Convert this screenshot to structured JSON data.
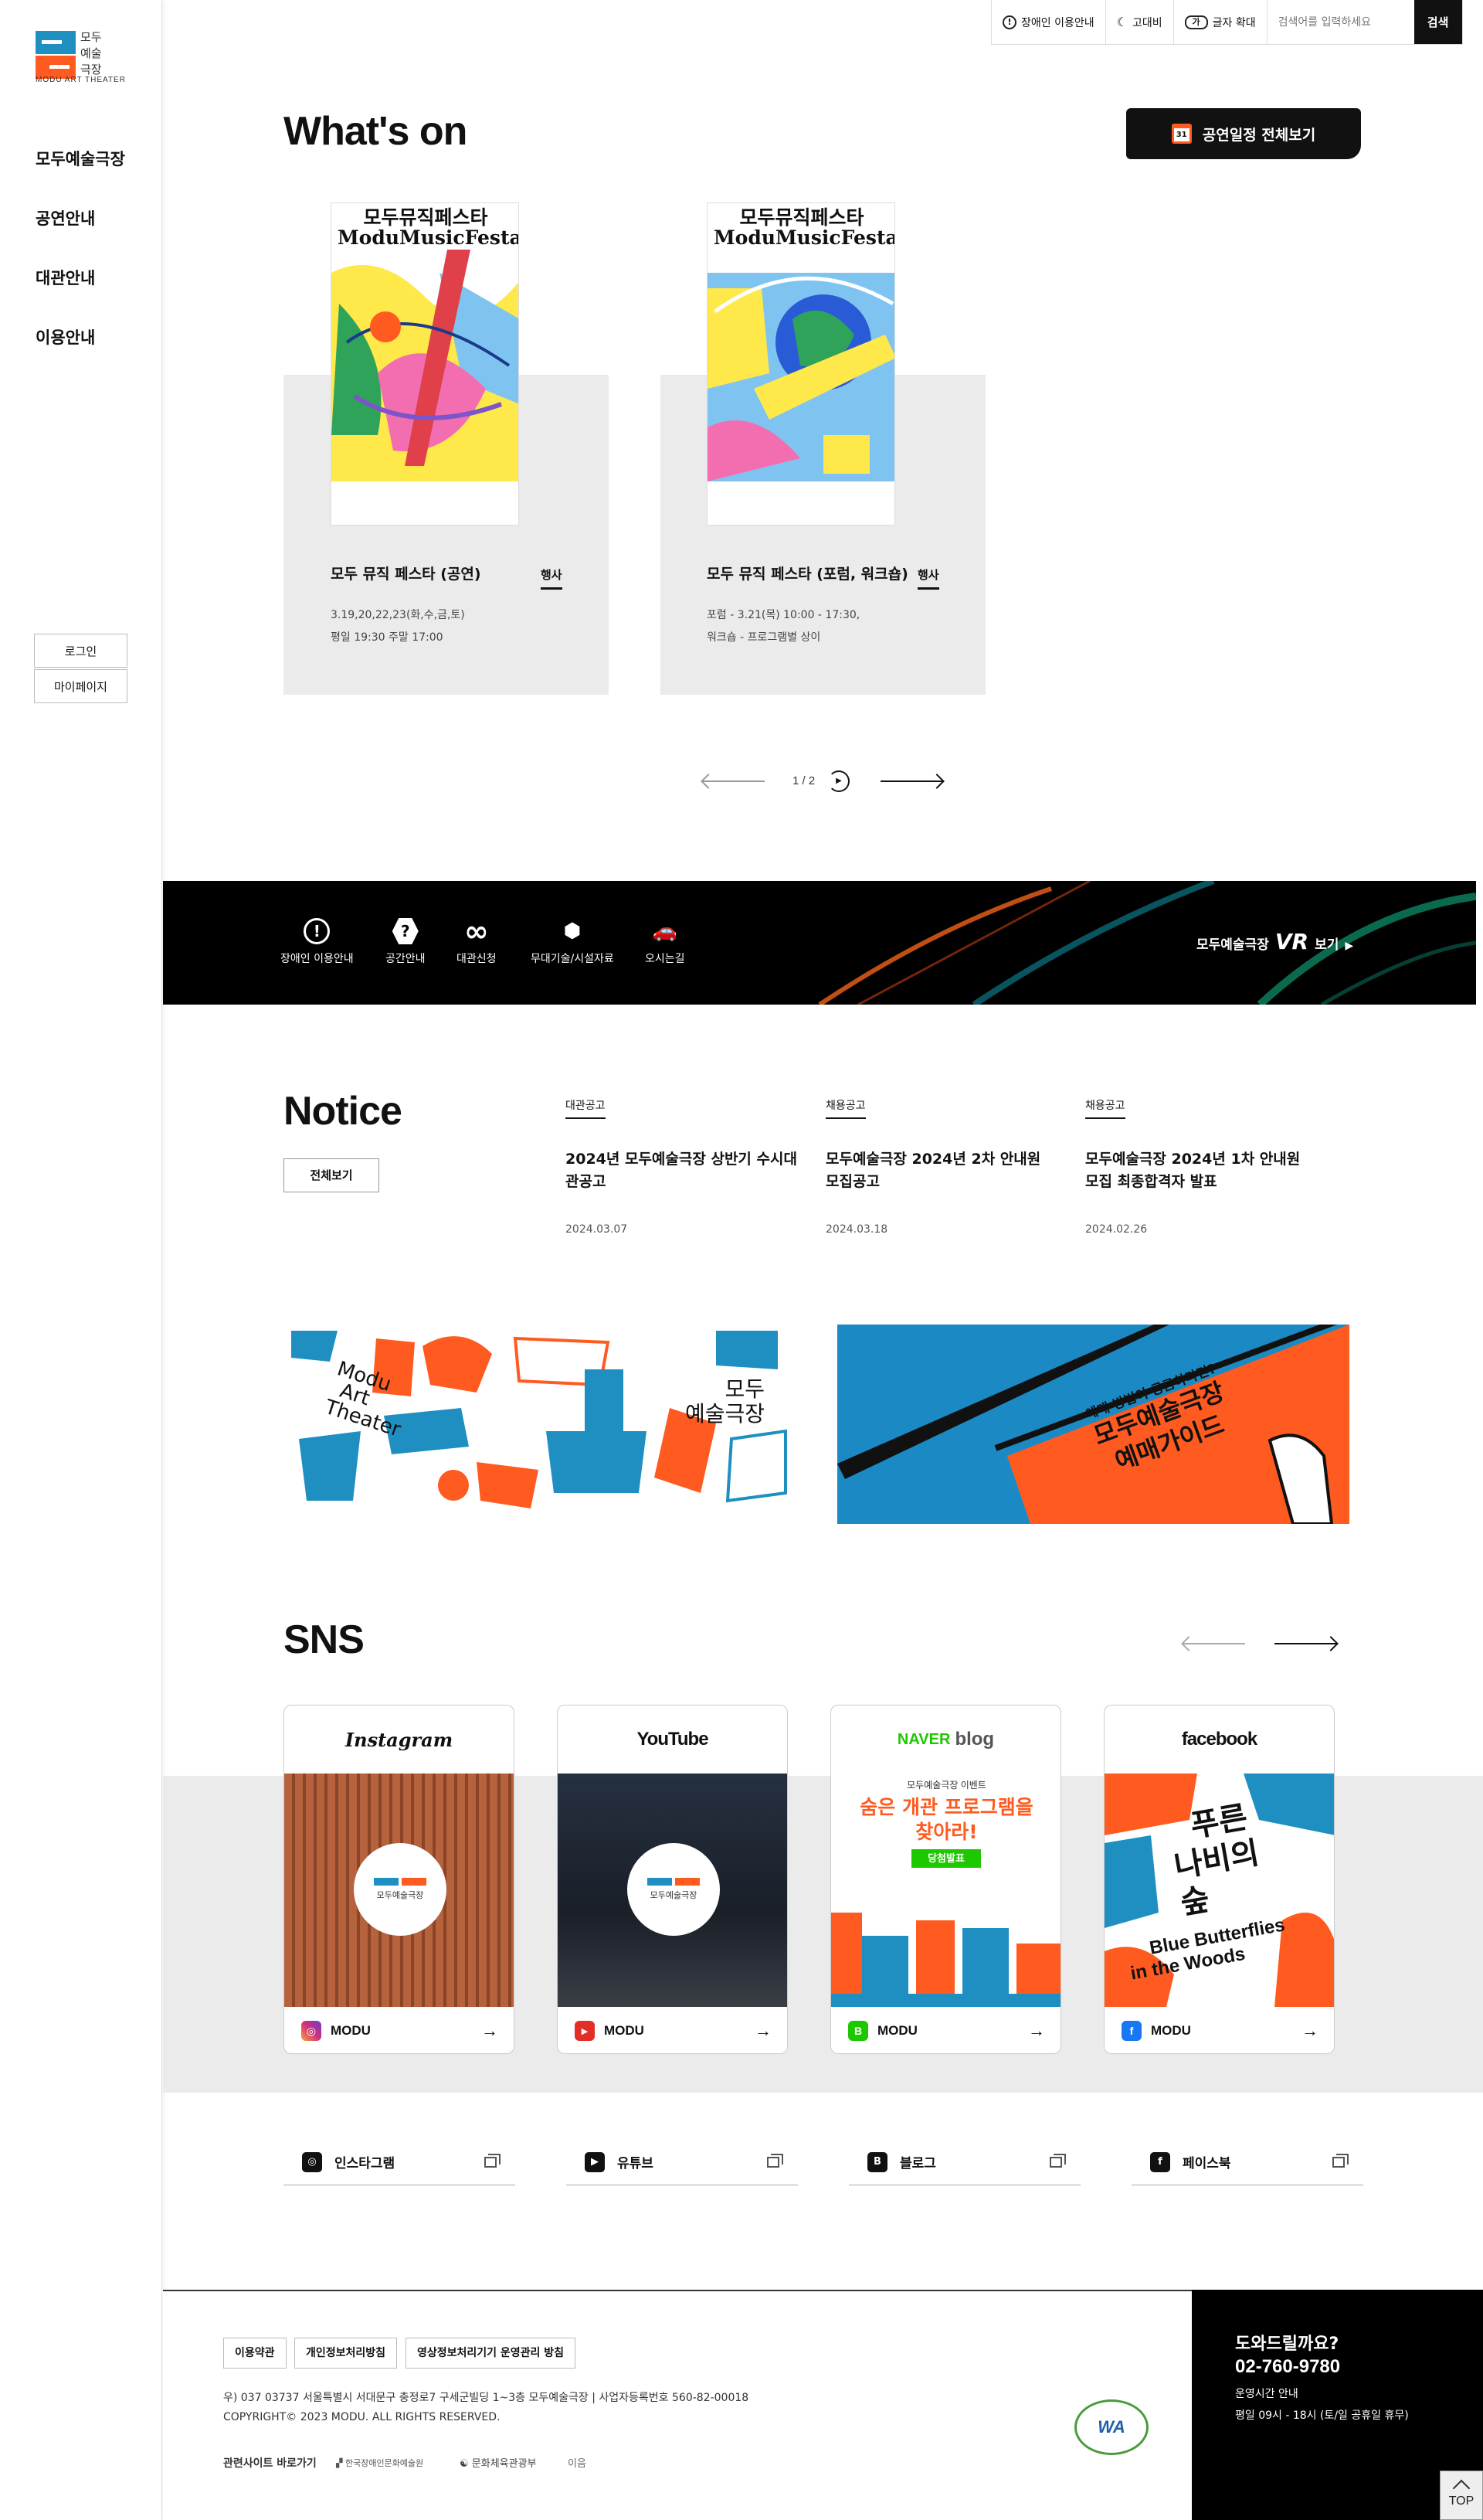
{
  "brand": {
    "logo_kr_1": "모두",
    "logo_kr_2": "예술",
    "logo_kr_3": "극장",
    "logo_en": "MODU ART THEATER"
  },
  "sidebar": {
    "nav": [
      "모두예술극장",
      "공연안내",
      "대관안내",
      "이용안내"
    ],
    "login": "로그인",
    "mypage": "마이페이지"
  },
  "topbar": {
    "access": "장애인 이용안내",
    "contrast": "고대비",
    "font": "글자 확대",
    "search_placeholder": "검색어를 입력하세요",
    "search_btn": "검색",
    "font_icon": "가",
    "access_icon": "!"
  },
  "whatson": {
    "heading": "What's on",
    "all_btn": "공연일정 전체보기",
    "cal_day": "31",
    "poster_title_kr": "모두뮤직페스타",
    "poster_title_en": "ModuMusicFesta",
    "cards": [
      {
        "title": "모두 뮤직 페스타 (공연)",
        "tag": "행사",
        "line1": "3.19,20,22,23(화,수,금,토)",
        "line2": "평일 19:30 주말 17:00"
      },
      {
        "title": "모두 뮤직 페스타 (포럼, 워크숍)",
        "tag": "행사",
        "line1": "포럼 - 3.21(목) 10:00 - 17:30,",
        "line2": "워크숍 - 프로그램별 상이"
      }
    ],
    "pager": "1 / 2"
  },
  "quick": {
    "items": [
      {
        "label": "장애인 이용안내",
        "icon": "!"
      },
      {
        "label": "공간안내",
        "icon": "?"
      },
      {
        "label": "대관신청",
        "icon": "∞"
      },
      {
        "label": "무대기술/시설자료",
        "icon": "⬢"
      },
      {
        "label": "오시는길",
        "icon": "🚗"
      }
    ],
    "vr_prefix": "모두예술극장",
    "vr_big": "VR",
    "vr_suffix": "보기"
  },
  "notice": {
    "heading": "Notice",
    "all_btn": "전체보기",
    "items": [
      {
        "category": "대관공고",
        "title": "2024년 모두예술극장 상반기 수시대관공고",
        "date": "2024.03.07"
      },
      {
        "category": "채용공고",
        "title": "모두예술극장 2024년 2차 안내원 모집공고",
        "date": "2024.03.18"
      },
      {
        "category": "채용공고",
        "title": "모두예술극장 2024년 1차 안내원 모집 최종합격자 발표",
        "date": "2024.02.26"
      }
    ]
  },
  "banners": {
    "left_en_1": "Modu",
    "left_en_2": "Art",
    "left_en_3": "Theater",
    "left_kr_1": "모두",
    "left_kr_2": "예술극장",
    "right_small": "예매 방법이 궁금하다면?",
    "right_big_1": "모두예술극장",
    "right_big_2": "예매가이드"
  },
  "sns": {
    "heading": "SNS",
    "cards": [
      {
        "head": "Instagram",
        "account": "MODU",
        "badge": "◎",
        "circle_label": "모두예술극장"
      },
      {
        "head": "YouTube",
        "account": "MODU",
        "badge": "▶",
        "circle_label": "모두예술극장"
      },
      {
        "head_a": "NAVER",
        "head_b": "blog",
        "account": "MODU",
        "badge": "B",
        "blog_title_1": "숨은 개관 프로그램을",
        "blog_title_2": "찾아라!",
        "blog_badge": "당첨발표",
        "blog_top": "모두예술극장 이벤트"
      },
      {
        "head": "facebook",
        "account": "MODU",
        "badge": "f",
        "fb_kr_1": "푸른",
        "fb_kr_2": "나비의",
        "fb_kr_3": "숲",
        "fb_en_1": "Blue Butterflies",
        "fb_en_2": "in the Woods"
      }
    ],
    "links": [
      {
        "label": "인스타그램",
        "badge": "◎"
      },
      {
        "label": "유튜브",
        "badge": "▶"
      },
      {
        "label": "블로그",
        "badge": "B"
      },
      {
        "label": "페이스북",
        "badge": "f"
      }
    ]
  },
  "footer": {
    "links": [
      "이용약관",
      "개인정보처리방침",
      "영상정보처리기기 운영관리 방침"
    ],
    "address": "우) 037 03737 서울특별시 서대문구 충정로7 구세군빌딩 1~3층 모두예술극장    |    사업자등록번호 560-82-00018",
    "copyright": "COPYRIGHT© 2023 MODU. ALL RIGHTS RESERVED.",
    "related": "관련사이트 바로가기",
    "related_1": "한국장애인문화예술원",
    "related_2": "문화체육관광부",
    "related_3": "이음",
    "wa_text": "WA",
    "help_title": "도와드릴까요?",
    "help_phone": "02-760-9780",
    "help_hours_title": "운영시간 안내",
    "help_hours": "평일 09시 - 18시 (토/일 공휴일 휴무)",
    "top": "TOP"
  },
  "colors": {
    "brand_blue": "#1f8fc2",
    "brand_orange": "#ff5a1f",
    "black": "#111111"
  }
}
